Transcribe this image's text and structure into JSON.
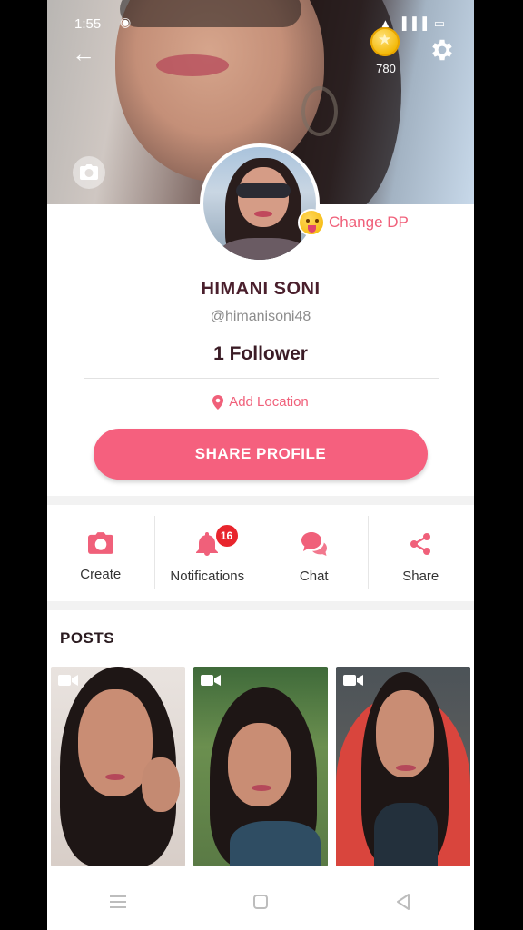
{
  "status": {
    "time": "1:55",
    "battery": "93"
  },
  "cover": {
    "coin_count": "780"
  },
  "profile": {
    "change_dp_label": "Change DP",
    "name": "HIMANI SONI",
    "handle": "@himanisoni48",
    "followers": "1 Follower",
    "location_label": "Add Location",
    "share_label": "SHARE PROFILE"
  },
  "actions": [
    {
      "label": "Create",
      "icon": "camera-icon"
    },
    {
      "label": "Notifications",
      "icon": "bell-icon",
      "badge": "16"
    },
    {
      "label": "Chat",
      "icon": "chat-icon"
    },
    {
      "label": "Share",
      "icon": "share-icon"
    }
  ],
  "posts": {
    "title": "POSTS",
    "items": [
      {
        "type": "video"
      },
      {
        "type": "video"
      },
      {
        "type": "video"
      }
    ]
  },
  "colors": {
    "accent": "#f5607e",
    "accent_text": "#f0607a",
    "badge": "#e8252d",
    "name": "#4a1f2c"
  }
}
